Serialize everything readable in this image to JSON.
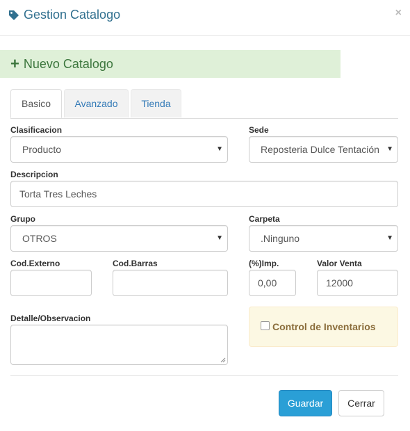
{
  "header": {
    "title": "Gestion Catalogo",
    "close": "×"
  },
  "banner": {
    "plus": "+",
    "text": "Nuevo Catalogo"
  },
  "tabs": [
    {
      "label": "Basico"
    },
    {
      "label": "Avanzado"
    },
    {
      "label": "Tienda"
    }
  ],
  "form": {
    "clasificacion": {
      "label": "Clasificacion",
      "value": "Producto"
    },
    "sede": {
      "label": "Sede",
      "value": "Reposteria Dulce Tentación"
    },
    "descripcion": {
      "label": "Descripcion",
      "value": "Torta Tres Leches"
    },
    "grupo": {
      "label": "Grupo",
      "value": "OTROS"
    },
    "carpeta": {
      "label": "Carpeta",
      "value": ".Ninguno"
    },
    "cod_externo": {
      "label": "Cod.Externo",
      "value": ""
    },
    "cod_barras": {
      "label": "Cod.Barras",
      "value": ""
    },
    "imp": {
      "label": "(%)Imp.",
      "value": "0,00"
    },
    "valor_venta": {
      "label": "Valor Venta",
      "value": "12000"
    },
    "detalle": {
      "label": "Detalle/Observacion",
      "value": ""
    },
    "control_inventarios": {
      "label": "Control de Inventarios",
      "checked": false
    }
  },
  "buttons": {
    "save": "Guardar",
    "close": "Cerrar"
  },
  "colors": {
    "title": "#31708f",
    "banner_bg": "#dff0d8",
    "banner_text": "#3c763d",
    "primary": "#2a9fd6",
    "warning_bg": "#fcf8e3",
    "warning_text": "#8a6d3b"
  },
  "icons": {
    "title": "tag-icon",
    "caret": "caret-down-icon",
    "plus": "plus-icon"
  }
}
